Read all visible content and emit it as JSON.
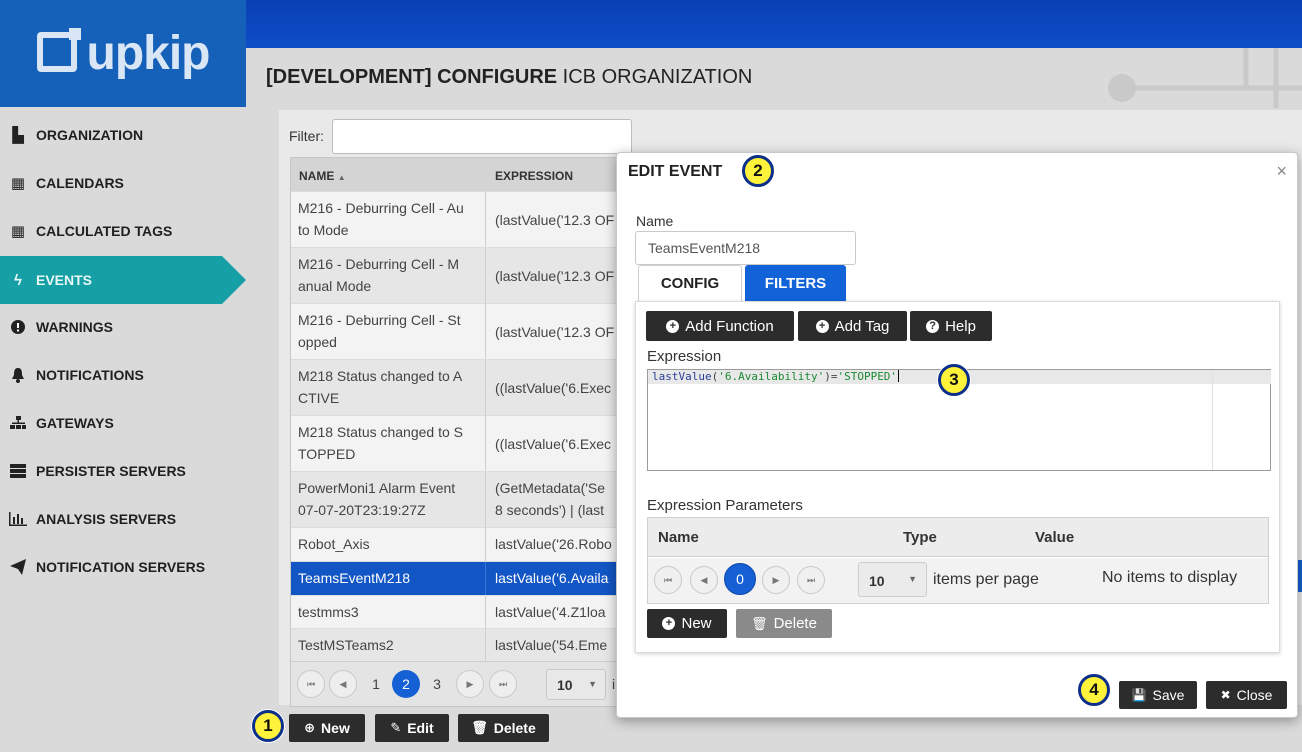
{
  "brand": {
    "logo_text": "upkip"
  },
  "sidebar": {
    "items": [
      {
        "label": "ORGANIZATION",
        "icon": "factory-icon",
        "glyph": "▙"
      },
      {
        "label": "CALENDARS",
        "icon": "calendar-icon",
        "glyph": "▦"
      },
      {
        "label": "CALCULATED TAGS",
        "icon": "calculator-icon",
        "glyph": "▦"
      },
      {
        "label": "EVENTS",
        "icon": "bolt-icon",
        "glyph": "ϟ",
        "active": true
      },
      {
        "label": "WARNINGS",
        "icon": "exclamation-circle-icon",
        "glyph": "❗"
      },
      {
        "label": "NOTIFICATIONS",
        "icon": "bell-icon",
        "glyph": "🔔"
      },
      {
        "label": "GATEWAYS",
        "icon": "sitemap-icon",
        "glyph": "⊥"
      },
      {
        "label": "PERSISTER SERVERS",
        "icon": "server-icon",
        "glyph": "☰"
      },
      {
        "label": "ANALYSIS SERVERS",
        "icon": "bar-chart-icon",
        "glyph": "▟"
      },
      {
        "label": "NOTIFICATION SERVERS",
        "icon": "paper-plane-icon",
        "glyph": "➤"
      }
    ]
  },
  "header": {
    "title_bold": "[DEVELOPMENT] CONFIGURE",
    "title_rest": " ICB ORGANIZATION"
  },
  "filter": {
    "label": "Filter:",
    "value": ""
  },
  "events_grid": {
    "columns": [
      "NAME",
      "EXPRESSION"
    ],
    "sort_indicator": "▲",
    "rows": [
      {
        "name": "M216 - Deburring Cell - Au to Mode",
        "expression": "(lastValue('12.3 OF"
      },
      {
        "name": "M216 - Deburring Cell - M anual Mode",
        "expression": "(lastValue('12.3 OF"
      },
      {
        "name": "M216 - Deburring Cell - St opped",
        "expression": "(lastValue('12.3 OF"
      },
      {
        "name": "M218 Status changed to A CTIVE",
        "expression": "((lastValue('6.Exec"
      },
      {
        "name": "M218 Status changed to S TOPPED",
        "expression": "((lastValue('6.Exec"
      },
      {
        "name": "PowerMoni1 Alarm Event 07-07-20T23:19:27Z",
        "expression": "(GetMetadata('Se 8 seconds') | (last"
      },
      {
        "name": "Robot_Axis",
        "expression": "lastValue('26.Robo"
      },
      {
        "name": "TeamsEventM218",
        "expression": "lastValue('6.Availa",
        "selected": true
      },
      {
        "name": "testmms3",
        "expression": "lastValue('4.Z1loa"
      },
      {
        "name": "TestMSTeams2",
        "expression": "lastValue('54.Eme"
      }
    ],
    "pager": {
      "pages": [
        "1",
        "2",
        "3"
      ],
      "current": "2",
      "page_size": "10",
      "trailing": "i"
    }
  },
  "actions": {
    "new": "New",
    "edit": "Edit",
    "delete": "Delete"
  },
  "modal": {
    "title": "EDIT EVENT",
    "close_glyph": "×",
    "name_label": "Name",
    "name_value": "TeamsEventM218",
    "tabs": {
      "config": "CONFIG",
      "filters": "FILTERS"
    },
    "toolbar": {
      "add_function": "Add Function",
      "add_tag": "Add Tag",
      "help": "Help"
    },
    "expression_label": "Expression",
    "expression": {
      "fn": "lastValue",
      "open": "(",
      "arg": "'6.Availability'",
      "close": ")",
      "op": "=",
      "value": "'STOPPED'"
    },
    "params_label": "Expression Parameters",
    "params_columns": [
      "Name",
      "Type",
      "Value"
    ],
    "params_pager": {
      "current": "0",
      "page_size": "10",
      "per_page_label": "items per page",
      "empty": "No items to display"
    },
    "params_new": "New",
    "params_delete": "Delete",
    "save": "Save",
    "close": "Close"
  },
  "callouts": [
    "1",
    "2",
    "3",
    "4"
  ],
  "colors": {
    "brand_blue": "#1560b8",
    "active_teal": "#16a0a5",
    "selected_row": "#1255c4",
    "callout_yellow": "#fff23a"
  }
}
